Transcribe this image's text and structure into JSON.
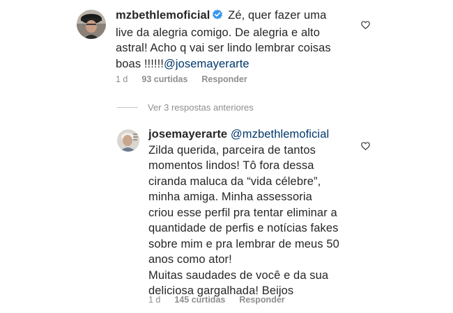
{
  "comment": {
    "username": "mzbethlemoficial",
    "text_line1": "Zé, quer fazer uma",
    "text_line2": "live da alegria comigo. De alegria e alto",
    "text_line3": "astral! Acho q vai ser lindo lembrar coisas",
    "text_line4_prefix": "boas !!!!!!",
    "mention": "@josemayerarte",
    "time": "1 d",
    "likes": "93 curtidas",
    "reply_label": "Responder"
  },
  "view_replies_label": "Ver 3 respostas anteriores",
  "reply": {
    "username": "josemayerarte",
    "mention": "@mzbethlemoficial",
    "lines": [
      "Zilda querida, parceira de tantos",
      "momentos lindos! Tô fora dessa",
      "ciranda maluca da “vida célebre”,",
      "minha amiga. Minha assessoria",
      "criou esse perfil pra tentar eliminar a",
      "quantidade de perfis e notícias fakes",
      "sobre mim e pra lembrar de meus 50",
      "anos como ator!",
      "Muitas saudades de você e da sua",
      "deliciosa gargalhada! Beijos"
    ],
    "time": "1 d",
    "likes": "145 curtidas",
    "reply_label": "Responder"
  },
  "colors": {
    "text": "#262626",
    "secondary": "#8e8e8e",
    "mention": "#00376b",
    "verified": "#3897f0"
  }
}
